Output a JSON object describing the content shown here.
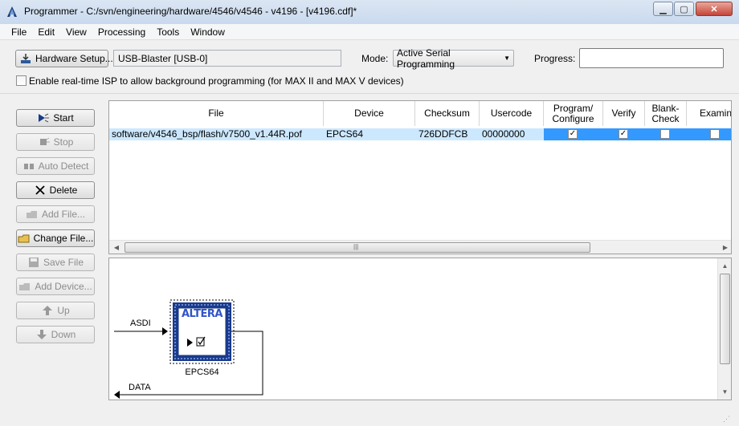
{
  "window": {
    "title": "Programmer - C:/svn/engineering/hardware/4546/v4546 - v4196 - [v4196.cdf]*",
    "app_icon": "quartus-programmer-icon",
    "controls": {
      "minimize": "minimize-icon",
      "maximize": "maximize-icon",
      "close": "close-icon"
    }
  },
  "menu": {
    "items": [
      {
        "label": "File"
      },
      {
        "label": "Edit"
      },
      {
        "label": "View"
      },
      {
        "label": "Processing"
      },
      {
        "label": "Tools"
      },
      {
        "label": "Window"
      }
    ]
  },
  "toolbar": {
    "hardware_setup_label": "Hardware Setup...",
    "hardware_value": "USB-Blaster [USB-0]",
    "mode_label": "Mode:",
    "mode_value": "Active Serial Programming",
    "progress_label": "Progress:",
    "progress_value": "",
    "isp_label": "Enable real-time ISP to allow background programming (for MAX II and MAX V devices)",
    "isp_checked": false
  },
  "sidebar": {
    "buttons": [
      {
        "label": "Start",
        "icon": "start-icon",
        "enabled": true
      },
      {
        "label": "Stop",
        "icon": "stop-icon",
        "enabled": false
      },
      {
        "label": "Auto Detect",
        "icon": "auto-detect-icon",
        "enabled": false
      },
      {
        "label": "Delete",
        "icon": "delete-icon",
        "enabled": true
      },
      {
        "label": "Add File...",
        "icon": "add-file-icon",
        "enabled": false
      },
      {
        "label": "Change File...",
        "icon": "change-file-icon",
        "enabled": true
      },
      {
        "label": "Save File",
        "icon": "save-file-icon",
        "enabled": false
      },
      {
        "label": "Add Device...",
        "icon": "add-device-icon",
        "enabled": false
      },
      {
        "label": "Up",
        "icon": "up-icon",
        "enabled": false
      },
      {
        "label": "Down",
        "icon": "down-icon",
        "enabled": false
      }
    ]
  },
  "table": {
    "columns": [
      "File",
      "Device",
      "Checksum",
      "Usercode",
      "Program/ Configure",
      "Verify",
      "Blank- Check",
      "Examine"
    ],
    "rows": [
      {
        "file": "software/v4546_bsp/flash/v7500_v1.44R.pof",
        "device": "EPCS64",
        "checksum": "726DDFCB",
        "usercode": "00000000",
        "program": true,
        "verify": true,
        "blank_check": false,
        "examine": false
      }
    ]
  },
  "diagram": {
    "asdi_label": "ASDI",
    "data_label": "DATA",
    "chip_logo": "ALTERA",
    "chip_name": "EPCS64"
  },
  "colors": {
    "selection": "#3399ff",
    "row_bg": "#cce8ff",
    "titlebar": "#c9d9ee",
    "chip_border": "#1a3a8a"
  }
}
